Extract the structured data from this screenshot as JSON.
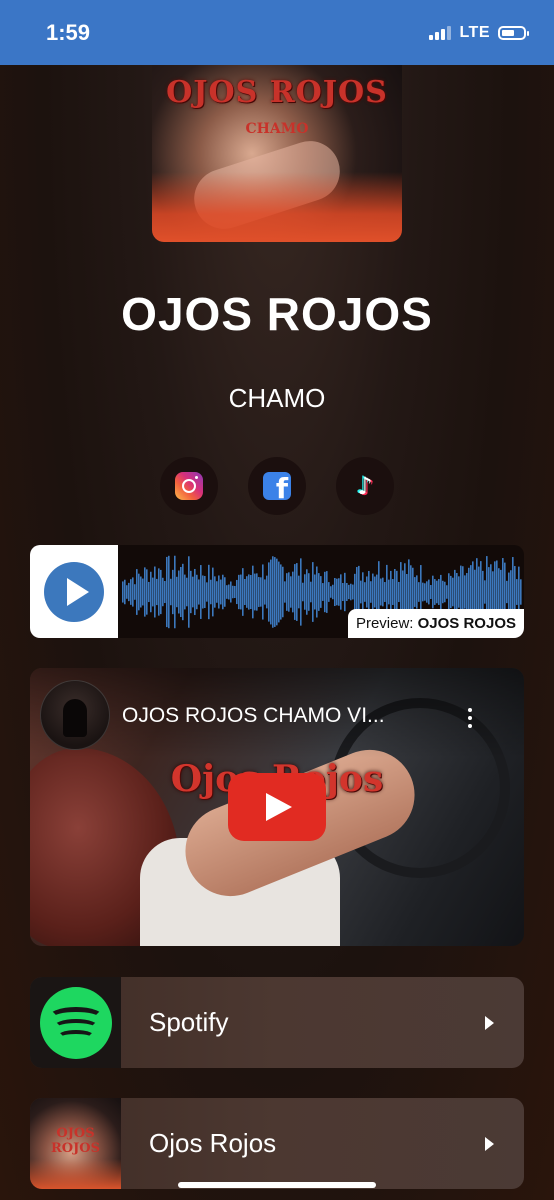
{
  "status_bar": {
    "time": "1:59",
    "network": "LTE",
    "signal_bars": "3 of 4",
    "color": "#3b76c6"
  },
  "album": {
    "art_title": "OJOS ROJOS",
    "art_artist": "CHAMO",
    "title": "OJOS ROJOS",
    "artist": "CHAMO"
  },
  "social": [
    {
      "name": "instagram",
      "icon": "instagram-icon"
    },
    {
      "name": "facebook",
      "icon": "facebook-icon"
    },
    {
      "name": "tiktok",
      "icon": "tiktok-icon"
    }
  ],
  "audio_preview": {
    "prefix": "Preview: ",
    "track": "OJOS ROJOS",
    "play_color": "#3c78bd",
    "wave_color": "#3c78bd"
  },
  "video": {
    "title": "OJOS ROJOS CHAMO VI...",
    "overlay_text": "Ojos Rojos",
    "play_color": "#e12b22"
  },
  "links": [
    {
      "label": "Spotify",
      "icon": "spotify-icon",
      "color": "#1ed760"
    },
    {
      "label": "Ojos Rojos",
      "icon": "album-thumbnail"
    }
  ]
}
